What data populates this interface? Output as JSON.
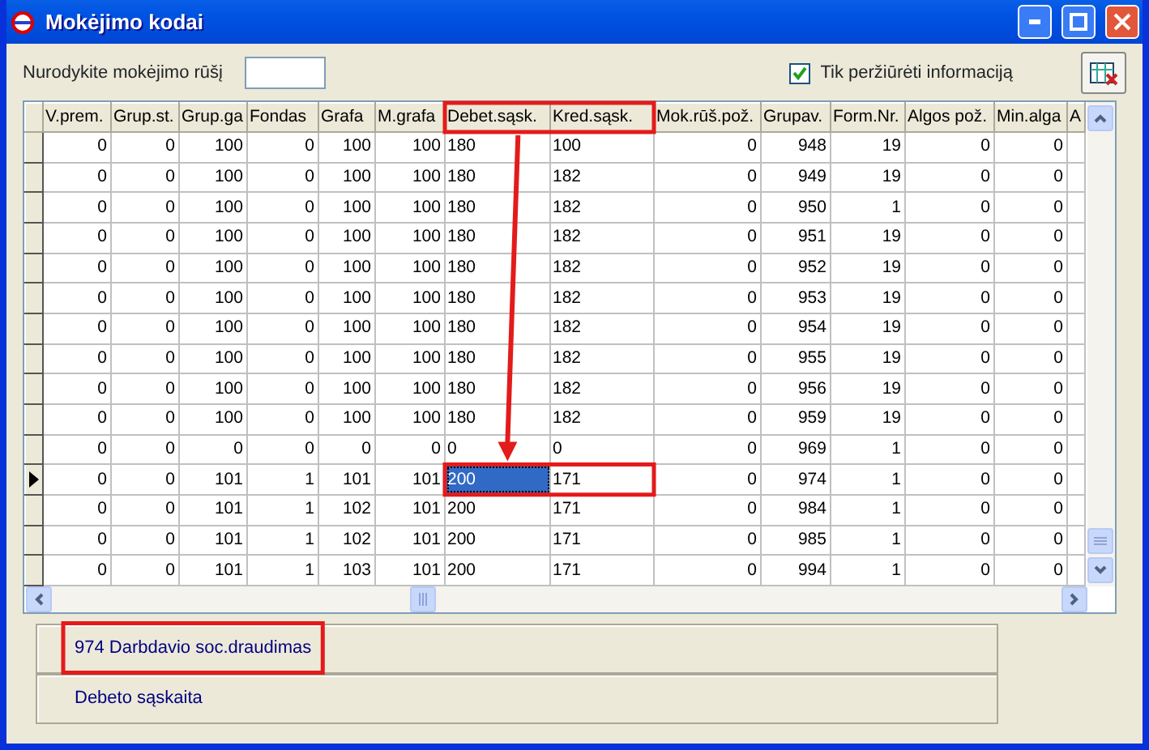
{
  "window": {
    "title": "Mokėjimo kodai"
  },
  "filter": {
    "label": "Nurodykite mokėjimo rūšį"
  },
  "view_only": {
    "label": "Tik peržiūrėti informaciją",
    "checked": true
  },
  "table": {
    "columns": [
      {
        "label": "V.prem.",
        "kind": "number",
        "focused": false
      },
      {
        "label": "Grup.st.",
        "kind": "number",
        "focused": false
      },
      {
        "label": "Grup.ga",
        "kind": "number",
        "focused": false
      },
      {
        "label": "Fondas",
        "kind": "number",
        "focused": false
      },
      {
        "label": "Grafa",
        "kind": "number",
        "focused": false
      },
      {
        "label": "M.grafa",
        "kind": "number",
        "focused": false
      },
      {
        "label": "Debet.sąsk.",
        "kind": "text",
        "focused": true
      },
      {
        "label": "Kred.sąsk.",
        "kind": "text",
        "focused": false
      },
      {
        "label": "Mok.rūš.pož.",
        "kind": "number",
        "focused": false
      },
      {
        "label": "Grupav.",
        "kind": "number",
        "focused": false
      },
      {
        "label": "Form.Nr.",
        "kind": "number",
        "focused": false
      },
      {
        "label": "Algos pož.",
        "kind": "number",
        "focused": false
      },
      {
        "label": "Min.alga",
        "kind": "number",
        "focused": false
      },
      {
        "label": "A",
        "kind": "text",
        "focused": false
      }
    ],
    "rows": [
      {
        "current": false,
        "cells": [
          "0",
          "0",
          "100",
          "0",
          "100",
          "100",
          "180",
          "100",
          "0",
          "948",
          "19",
          "0",
          "0"
        ]
      },
      {
        "current": false,
        "cells": [
          "0",
          "0",
          "100",
          "0",
          "100",
          "100",
          "180",
          "182",
          "0",
          "949",
          "19",
          "0",
          "0"
        ]
      },
      {
        "current": false,
        "cells": [
          "0",
          "0",
          "100",
          "0",
          "100",
          "100",
          "180",
          "182",
          "0",
          "950",
          "1",
          "0",
          "0"
        ]
      },
      {
        "current": false,
        "cells": [
          "0",
          "0",
          "100",
          "0",
          "100",
          "100",
          "180",
          "182",
          "0",
          "951",
          "19",
          "0",
          "0"
        ]
      },
      {
        "current": false,
        "cells": [
          "0",
          "0",
          "100",
          "0",
          "100",
          "100",
          "180",
          "182",
          "0",
          "952",
          "19",
          "0",
          "0"
        ]
      },
      {
        "current": false,
        "cells": [
          "0",
          "0",
          "100",
          "0",
          "100",
          "100",
          "180",
          "182",
          "0",
          "953",
          "19",
          "0",
          "0"
        ]
      },
      {
        "current": false,
        "cells": [
          "0",
          "0",
          "100",
          "0",
          "100",
          "100",
          "180",
          "182",
          "0",
          "954",
          "19",
          "0",
          "0"
        ]
      },
      {
        "current": false,
        "cells": [
          "0",
          "0",
          "100",
          "0",
          "100",
          "100",
          "180",
          "182",
          "0",
          "955",
          "19",
          "0",
          "0"
        ]
      },
      {
        "current": false,
        "cells": [
          "0",
          "0",
          "100",
          "0",
          "100",
          "100",
          "180",
          "182",
          "0",
          "956",
          "19",
          "0",
          "0"
        ]
      },
      {
        "current": false,
        "cells": [
          "0",
          "0",
          "100",
          "0",
          "100",
          "100",
          "180",
          "182",
          "0",
          "959",
          "19",
          "0",
          "0"
        ]
      },
      {
        "current": false,
        "cells": [
          "0",
          "0",
          "0",
          "0",
          "0",
          "0",
          "0",
          "0",
          "0",
          "969",
          "1",
          "0",
          "0"
        ]
      },
      {
        "current": true,
        "cells": [
          "0",
          "0",
          "101",
          "1",
          "101",
          "101",
          "200",
          "171",
          "0",
          "974",
          "1",
          "0",
          "0"
        ]
      },
      {
        "current": false,
        "cells": [
          "0",
          "0",
          "101",
          "1",
          "102",
          "101",
          "200",
          "171",
          "0",
          "984",
          "1",
          "0",
          "0"
        ]
      },
      {
        "current": false,
        "cells": [
          "0",
          "0",
          "101",
          "1",
          "102",
          "101",
          "200",
          "171",
          "0",
          "985",
          "1",
          "0",
          "0"
        ]
      },
      {
        "current": false,
        "cells": [
          "0",
          "0",
          "101",
          "1",
          "103",
          "101",
          "200",
          "171",
          "0",
          "994",
          "1",
          "0",
          "0"
        ]
      }
    ]
  },
  "info_panels": [
    "974 Darbdavio soc.draudimas",
    "Debeto sąskaita"
  ]
}
